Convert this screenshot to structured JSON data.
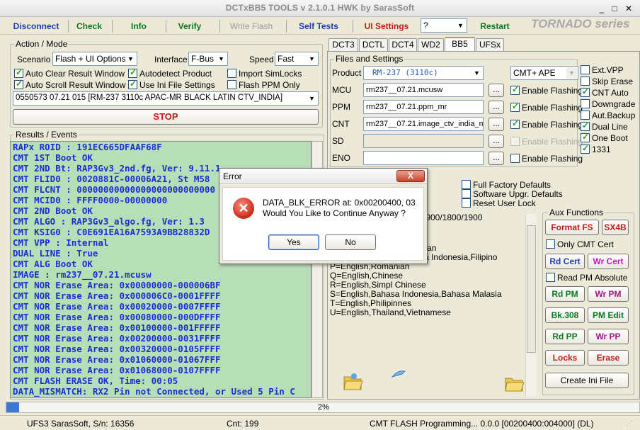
{
  "window": {
    "title": "DCTxBB5 TOOLS v 2.1.0.1 HWK by SarasSoft",
    "min": "_",
    "max": "□",
    "close": "✕"
  },
  "toolbar": {
    "disconnect": "Disconnect",
    "check": "Check",
    "info": "Info",
    "verify": "Verify",
    "write_flash": "Write Flash",
    "self_tests": "Self Tests",
    "ui_settings": "UI Settings",
    "combo_value": "?",
    "restart": "Restart",
    "brand": "TORNADO series"
  },
  "action_mode": {
    "legend": "Action / Mode",
    "scenario_label": "Scenario",
    "scenario_value": "Flash + UI Options",
    "interface_label": "Interface",
    "interface_value": "F-Bus",
    "speed_label": "Speed",
    "speed_value": "Fast",
    "checkboxes": [
      {
        "label": "Auto Clear Result Window",
        "checked": true
      },
      {
        "label": "Autodetect Product",
        "checked": true
      },
      {
        "label": "Import SimLocks",
        "checked": false
      },
      {
        "label": "Auto Scroll Result Window",
        "checked": true
      },
      {
        "label": "Use Ini File Settings",
        "checked": true
      },
      {
        "label": "Flash PPM Only",
        "checked": false
      }
    ],
    "product_combo": "0550573 07.21 015  [RM-237 3110c APAC-MR BLACK LATIN CTV_INDIA]",
    "stop_button": "STOP"
  },
  "results": {
    "legend": "Results / Events",
    "lines": [
      "RAPx ROID : 191EC665DFAAF68F",
      "CMT 1ST Boot OK",
      "CMT 2ND Bt: RAP3Gv3_2nd.fg, Ver: 9.11.1",
      "CMT FLID0 : 0020881C-00006A21, St M58",
      "CMT FLCNT : 00000000000000000000000000",
      "CMT MCID0 : FFFF0000-00000000",
      "CMT 2ND Boot OK",
      "CMT ALGO  : RAP3Gv3_algo.fg, Ver: 1.3",
      "CMT KSIG0 : C0E691EA16A7593A9BB28832D",
      "CMT VPP   : Internal",
      "DUAL LINE : True",
      "CMT ALG Boot OK",
      "IMAGE : rm237__07.21.mcusw",
      "CMT NOR Erase Area: 0x00000000-000006BF",
      "CMT NOR Erase Area: 0x000006C0-0001FFFF",
      "CMT NOR Erase Area: 0x00020000-0007FFFF",
      "CMT NOR Erase Area: 0x00080000-000DFFFF",
      "CMT NOR Erase Area: 0x00100000-001FFFFF",
      "CMT NOR Erase Area: 0x00200000-0031FFFF",
      "CMT NOR Erase Area: 0x00320000-0105FFFF",
      "CMT NOR Erase Area: 0x01060000-01067FFF",
      "CMT NOR Erase Area: 0x01068000-0107FFFF",
      "CMT FLASH ERASE OK, Time: 00:05",
      "DATA_MISMATCH: RX2 Pin not Connected, or Used 5 Pin C"
    ]
  },
  "tabs": [
    "DCT3",
    "DCTL",
    "DCT4",
    "WD2",
    "BB5",
    "UFSx"
  ],
  "active_tab": "BB5",
  "files": {
    "legend": "Files and Settings",
    "product_label": "Product",
    "product_value": "RM-237  (3110c)",
    "mode_value": "CMT+ APE",
    "rows": [
      {
        "label": "MCU",
        "value": "rm237__07.21.mcusw",
        "browse": "...",
        "flash_label": "Enable Flashing",
        "checked": true,
        "enabled": true
      },
      {
        "label": "PPM",
        "value": "rm237__07.21.ppm_mr",
        "browse": "...",
        "flash_label": "Enable Flashing",
        "checked": true,
        "enabled": true
      },
      {
        "label": "CNT",
        "value": "rm237__07.21.image_ctv_india_m",
        "browse": "...",
        "flash_label": "Enable Flashing",
        "checked": true,
        "enabled": true
      },
      {
        "label": "SD",
        "value": "",
        "browse": "...",
        "flash_label": "Enable Flashing",
        "checked": false,
        "enabled": false
      },
      {
        "label": "ENO",
        "value": "",
        "browse": "...",
        "flash_label": "Enable Flashing",
        "checked": false,
        "enabled": true
      }
    ],
    "options": [
      {
        "label": "Ext.VPP",
        "checked": false
      },
      {
        "label": "Skip Erase",
        "checked": false
      },
      {
        "label": "CNT Auto",
        "checked": true
      },
      {
        "label": "Downgrade",
        "checked": false
      },
      {
        "label": "Aut.Backup",
        "checked": false
      },
      {
        "label": "Dual Line",
        "checked": true
      },
      {
        "label": "One Boot",
        "checked": true
      },
      {
        "label": "1331",
        "checked": true
      }
    ]
  },
  "factory": [
    {
      "label": "Full Factory Defaults",
      "checked": false
    },
    {
      "label": "Software Upgr. Defaults",
      "checked": false
    },
    {
      "label": "Reset User Lock",
      "checked": false
    }
  ],
  "bands": "GSM900/1800/1900",
  "languages": [
    "F=English,Hebrew,Poland",
    "H=English,German,Greek",
    "I=English,Russian,Ukrainian",
    "MR=English,Hindi,Bahasa Indonesia,Filipino",
    "P=English,Romanian",
    "Q=English,Chinese",
    "R=English,Simpl Chinese",
    "S=English,Bahasa Indonesia,Bahasa Malasia",
    "T=English,Philipinnes",
    "U=English,Thailand,Vietnamese"
  ],
  "aux": {
    "legend": "Aux Functions",
    "format_fs": "Format FS",
    "sx4b": "SX4B",
    "only_cmt_cert": "Only CMT Cert",
    "rd_cert": "Rd Cert",
    "wr_cert": "Wr Cert",
    "read_pm_absolute": "Read PM Absolute",
    "rd_pm": "Rd PM",
    "wr_pm": "Wr PM",
    "bk308": "Bk.308",
    "pm_edit": "PM Edit",
    "rd_pp": "Rd PP",
    "wr_pp": "Wr PP",
    "locks": "Locks",
    "erase": "Erase",
    "create_ini": "Create Ini File"
  },
  "dialog": {
    "title": "Error",
    "close": "X",
    "message1": "DATA_BLK_ERROR at: 0x00200400, 03",
    "message2": "Would You Like to Continue Anyway ?",
    "yes": "Yes",
    "no": "No"
  },
  "progress": {
    "percent_label": "2%",
    "fraction": 0.02
  },
  "status": {
    "serial": "UFS3 SarasSoft, S/n: 16356",
    "count": "Cnt: 199",
    "message": "CMT FLASH Programming... 0.0.0 [00200400:004000] (DL)"
  },
  "colors": {
    "log_bg": "#b7dfb7",
    "log_text": "#1a2fd0",
    "accent_red": "#c81818",
    "accent_green": "#0a7a22",
    "progress": "#3c76d6"
  }
}
